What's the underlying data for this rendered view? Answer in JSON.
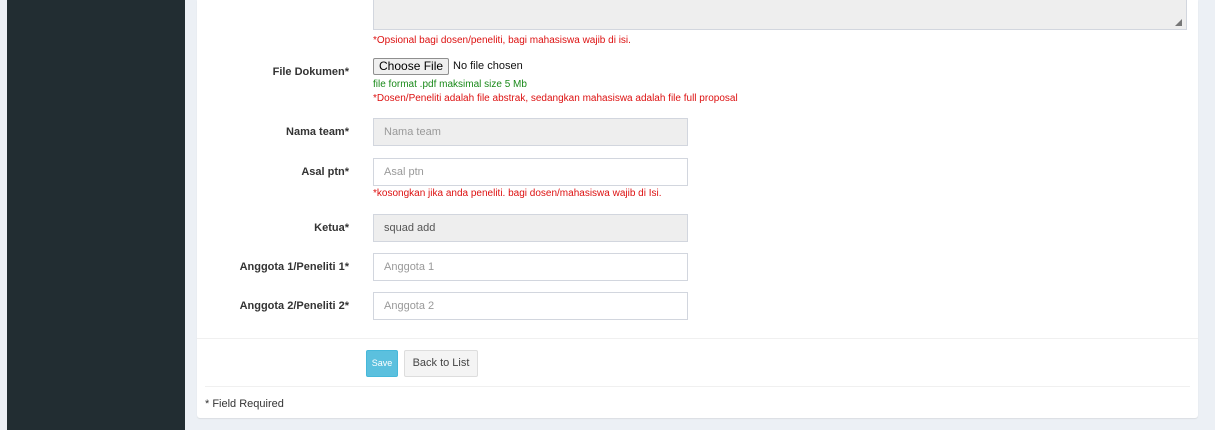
{
  "form": {
    "textarea_note": "*Opsional bagi dosen/peneliti, bagi mahasiswa wajib di isi.",
    "file_dokumen": {
      "label": "File Dokumen*",
      "button_label": "Choose File",
      "status": "No file chosen",
      "format_hint": "file format .pdf maksimal size 5 Mb",
      "note": "*Dosen/Peneliti adalah file abstrak, sedangkan mahasiswa adalah file full proposal"
    },
    "nama_team": {
      "label": "Nama team*",
      "placeholder": "Nama team"
    },
    "asal_ptn": {
      "label": "Asal ptn*",
      "placeholder": "Asal ptn",
      "note": "*kosongkan jika anda peneliti. bagi dosen/mahasiswa wajib di Isi."
    },
    "ketua": {
      "label": "Ketua*",
      "value": "squad add"
    },
    "anggota1": {
      "label": "Anggota 1/Peneliti 1*",
      "placeholder": "Anggota 1"
    },
    "anggota2": {
      "label": "Anggota 2/Peneliti 2*",
      "placeholder": "Anggota 2"
    }
  },
  "actions": {
    "save_label": "Save",
    "back_label": "Back to List"
  },
  "footer": {
    "required_note": "* Field Required"
  }
}
